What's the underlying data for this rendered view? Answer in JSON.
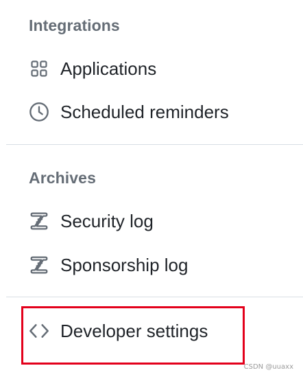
{
  "sections": {
    "integrations": {
      "heading": "Integrations",
      "items": [
        {
          "label": "Applications",
          "icon": "apps-grid-icon"
        },
        {
          "label": "Scheduled reminders",
          "icon": "clock-icon"
        }
      ]
    },
    "archives": {
      "heading": "Archives",
      "items": [
        {
          "label": "Security log",
          "icon": "log-icon"
        },
        {
          "label": "Sponsorship log",
          "icon": "log-icon"
        }
      ]
    },
    "developer": {
      "items": [
        {
          "label": "Developer settings",
          "icon": "code-icon"
        }
      ]
    }
  },
  "annotation": {
    "highlight_color": "#e3001b"
  },
  "watermark": "CSDN @uuaxx",
  "colors": {
    "heading": "#656d76",
    "text": "#1f2328",
    "icon": "#656d76",
    "divider": "#d8dee4"
  }
}
